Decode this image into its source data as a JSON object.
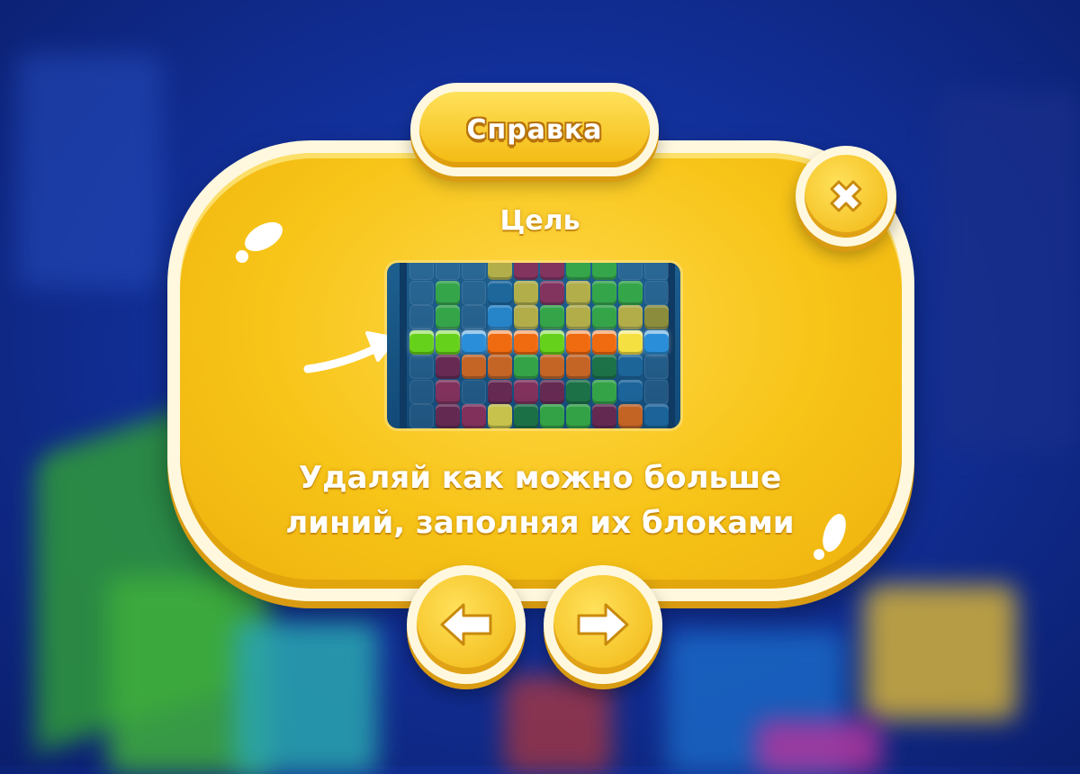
{
  "dialog": {
    "title": "Справка",
    "subtitle": "Цель",
    "description_line1": "Удаляй как можно больше",
    "description_line2": "линий, заполняя их блоками"
  },
  "buttons": {
    "close": "close-icon",
    "prev": "arrow-left-icon",
    "next": "arrow-right-icon"
  },
  "colors": {
    "panel": "#f7c418",
    "panel_border": "#fff8de",
    "background": "#12309a"
  }
}
